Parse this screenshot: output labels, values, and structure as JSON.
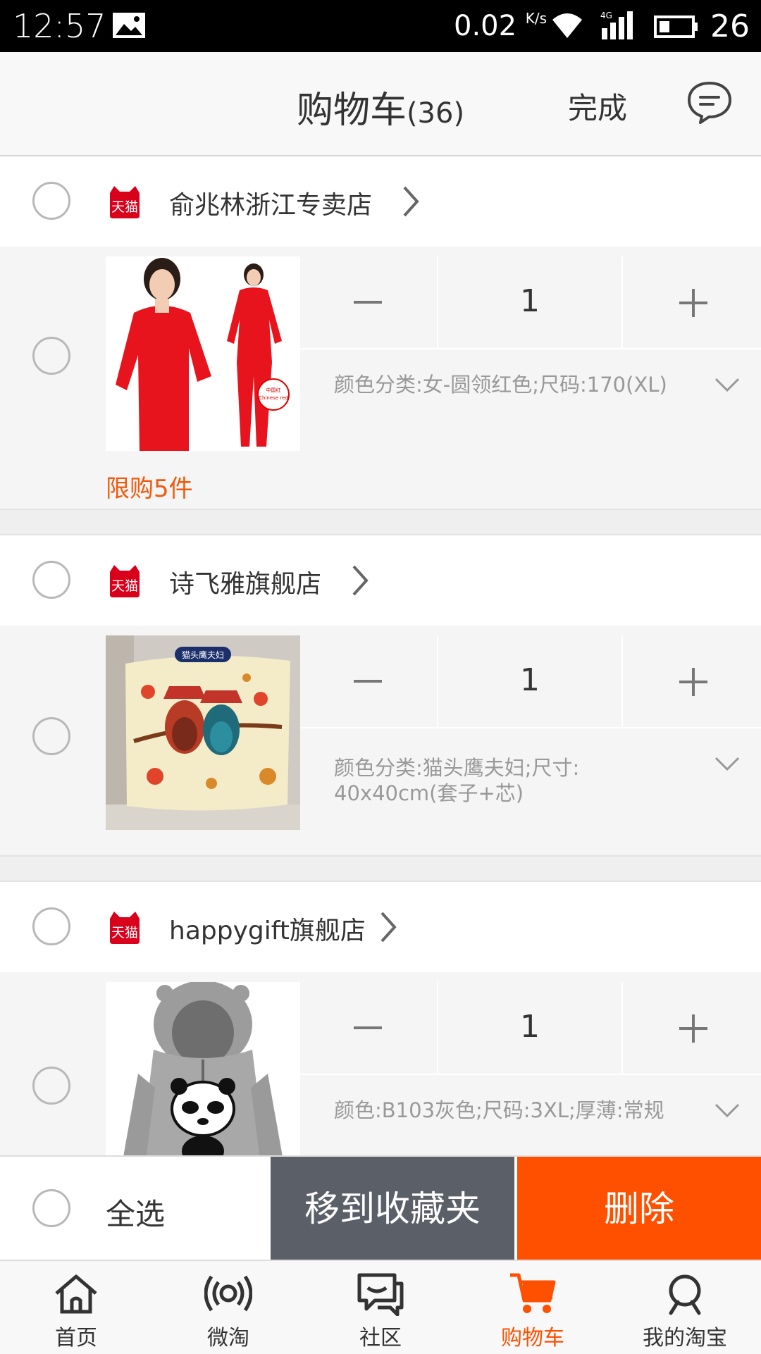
{
  "status_bar": {
    "time": "12:57",
    "speed": "0.02",
    "speed_unit": "K/s",
    "network": "4G",
    "battery": "26"
  },
  "header": {
    "title": "购物车",
    "count": "(36)",
    "done_label": "完成",
    "message_icon": "chat-bubble-icon"
  },
  "shops": [
    {
      "name": "俞兆林浙江专卖店",
      "badge": "天猫",
      "items": [
        {
          "quantity": "1",
          "sku": "颜色分类:女-圆领红色;尺码:170(XL)",
          "limit": "限购5件",
          "image_labels": [
            "中国红",
            "Chinese red"
          ]
        }
      ]
    },
    {
      "name": "诗飞雅旗舰店",
      "badge": "天猫",
      "items": [
        {
          "quantity": "1",
          "sku": "颜色分类:猫头鹰夫妇;尺寸:",
          "sku_line2": "40x40cm(套子+芯)",
          "image_labels": [
            "猫头鹰夫妇"
          ]
        }
      ]
    },
    {
      "name": "happygift旗舰店",
      "badge": "天猫",
      "items": [
        {
          "quantity": "1",
          "sku": "颜色:B103灰色;尺码:3XL;厚薄:常规"
        }
      ]
    }
  ],
  "action_bar": {
    "select_all": "全选",
    "move_to_favorites": "移到收藏夹",
    "delete": "删除"
  },
  "tabs": [
    {
      "label": "首页",
      "icon": "home-icon"
    },
    {
      "label": "微淘",
      "icon": "broadcast-icon"
    },
    {
      "label": "社区",
      "icon": "community-icon"
    },
    {
      "label": "购物车",
      "icon": "cart-icon",
      "active": true
    },
    {
      "label": "我的淘宝",
      "icon": "user-icon"
    }
  ],
  "colors": {
    "accent": "#ff5000",
    "dark_button": "#5b6068",
    "limit_text": "#f15a0c",
    "tmall_red": "#d8001a"
  }
}
